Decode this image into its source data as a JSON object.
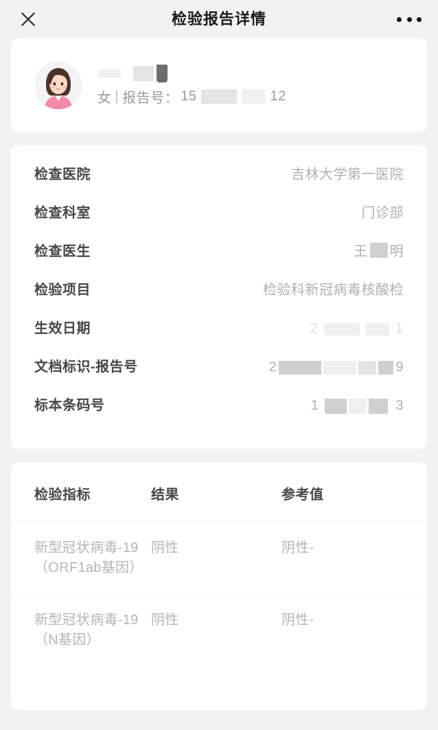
{
  "header": {
    "title": "检验报告详情",
    "close_icon": "close-icon",
    "more_icon": "more-options-icon"
  },
  "patient": {
    "avatar_icon": "female-avatar-icon",
    "name": "",
    "gender": "女",
    "separator": "|",
    "report_no_label": "报告号：",
    "report_no_prefix": "15",
    "report_no_suffix": "12"
  },
  "info": {
    "rows": [
      {
        "label": "检查医院",
        "value": "吉林大学第一医院",
        "redacted": false
      },
      {
        "label": "检查科室",
        "value": "门诊部",
        "redacted": false
      },
      {
        "label": "检查医生",
        "value_prefix": "王",
        "value_suffix": "明",
        "redacted": true
      },
      {
        "label": "检验项目",
        "value": "检验科新冠病毒核酸检",
        "redacted": false
      },
      {
        "label": "生效日期",
        "value_prefix": "2",
        "value_suffix": "1",
        "redacted": true
      },
      {
        "label": "文档标识-报告号",
        "value_prefix": "2",
        "value_suffix": "9",
        "redacted": true
      },
      {
        "label": "标本条码号",
        "value_prefix": "1",
        "value_suffix": "3",
        "redacted": true
      }
    ]
  },
  "result_table": {
    "headers": [
      "检验指标",
      "结果",
      "参考值"
    ],
    "rows": [
      {
        "indicator": "新型冠状病毒-19（ORF1ab基因）",
        "result": "阴性",
        "reference": "阴性-"
      },
      {
        "indicator": "新型冠状病毒-19（N基因）",
        "result": "阴性",
        "reference": "阴性-"
      }
    ]
  },
  "colors": {
    "page_background": "#f2f2f2",
    "card_background": "#ffffff",
    "label_text": "#474747",
    "value_text": "#b0b0b0",
    "title_text": "#1a1a1a"
  }
}
